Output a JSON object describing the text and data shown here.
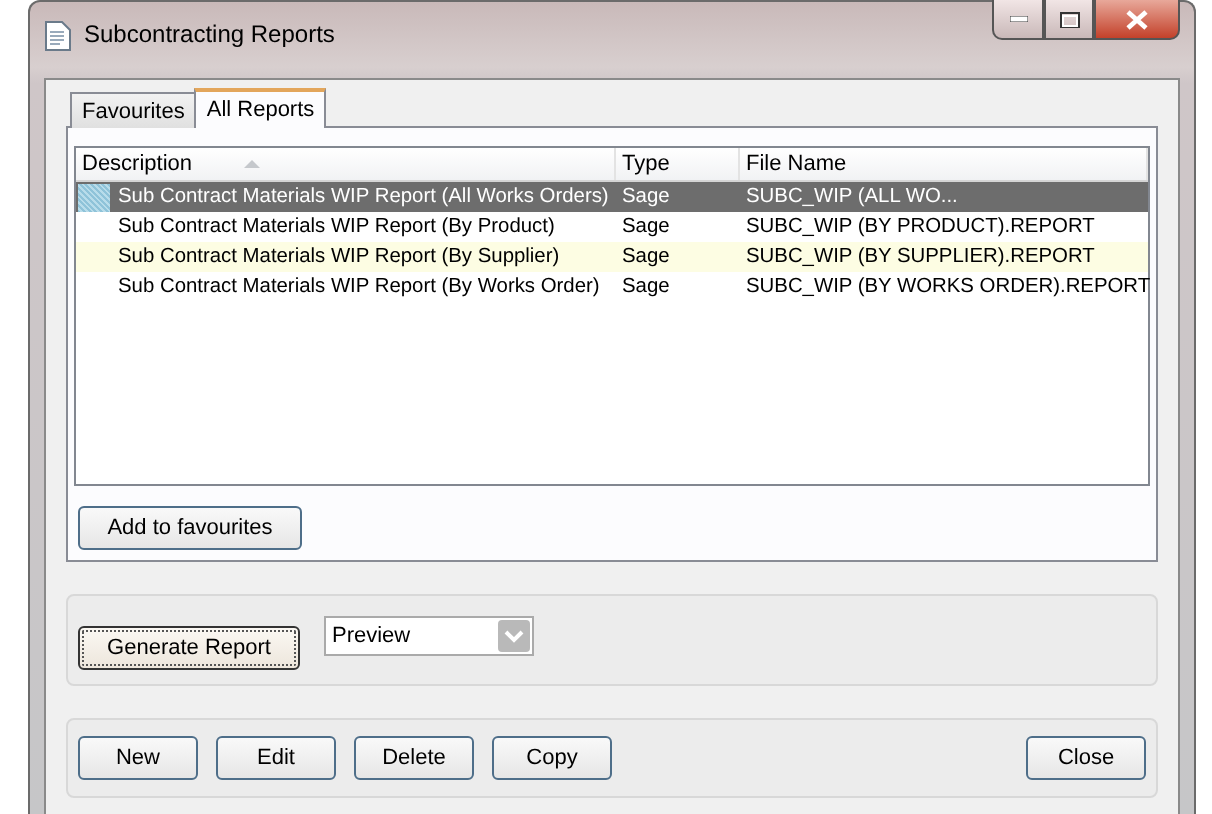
{
  "window": {
    "title": "Subcontracting Reports"
  },
  "tabs": [
    {
      "label": "Favourites",
      "selected": false
    },
    {
      "label": "All Reports",
      "selected": true
    }
  ],
  "table": {
    "columns": [
      "Description",
      "Type",
      "File Name"
    ],
    "rows": [
      {
        "cells": [
          "Sub Contract Materials WIP Report (All Works Orders)",
          "Sage",
          "SUBC_WIP (ALL WO..."
        ],
        "selected": true,
        "hovered": false
      },
      {
        "cells": [
          "Sub Contract Materials WIP Report (By Product)",
          "Sage",
          "SUBC_WIP (BY PRODUCT).REPORT"
        ],
        "selected": false,
        "hovered": false
      },
      {
        "cells": [
          "Sub Contract Materials WIP Report (By Supplier)",
          "Sage",
          "SUBC_WIP (BY SUPPLIER).REPORT"
        ],
        "selected": false,
        "hovered": true
      },
      {
        "cells": [
          "Sub Contract Materials WIP Report (By Works Order)",
          "Sage",
          "SUBC_WIP (BY WORKS ORDER).REPORT"
        ],
        "selected": false,
        "hovered": false
      }
    ]
  },
  "add_button": "Add to favourites",
  "generate_button": "Generate Report",
  "output_select": {
    "value": "Preview"
  },
  "actions": [
    "New",
    "Edit",
    "Delete",
    "Copy"
  ],
  "close_button": "Close"
}
